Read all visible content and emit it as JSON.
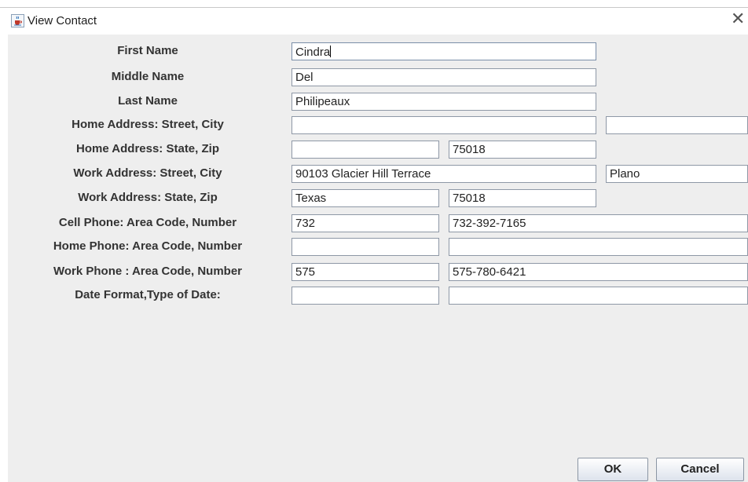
{
  "window": {
    "title": "View Contact",
    "icon": "java-cup-icon",
    "close": "close-icon"
  },
  "form": {
    "rows": [
      {
        "label": "First Name",
        "fields": [
          "Cindra"
        ]
      },
      {
        "label": "Middle Name",
        "fields": [
          "Del"
        ]
      },
      {
        "label": "Last Name",
        "fields": [
          "Philipeaux"
        ]
      },
      {
        "label": "Home Address: Street, City",
        "fields": [
          "",
          ""
        ]
      },
      {
        "label": "Home Address: State, Zip",
        "fields": [
          "",
          "75018"
        ]
      },
      {
        "label": "Work Address: Street, City",
        "fields": [
          "90103 Glacier Hill Terrace",
          "Plano"
        ]
      },
      {
        "label": "Work Address: State, Zip",
        "fields": [
          "Texas",
          "75018"
        ]
      },
      {
        "label": "Cell Phone: Area Code, Number",
        "fields": [
          "732",
          "732-392-7165"
        ]
      },
      {
        "label": "Home Phone: Area Code, Number",
        "fields": [
          "",
          ""
        ]
      },
      {
        "label": "Work Phone : Area Code, Number",
        "fields": [
          "575",
          "575-780-6421"
        ]
      },
      {
        "label": "Date Format,Type of Date:",
        "fields": [
          "",
          ""
        ]
      }
    ]
  },
  "buttons": {
    "ok": "OK",
    "cancel": "Cancel"
  }
}
